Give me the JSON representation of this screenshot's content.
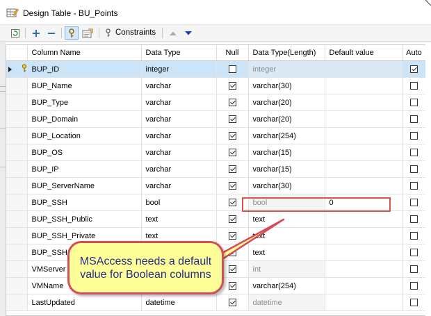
{
  "window": {
    "title": "Design Table - BU_Points"
  },
  "toolbar": {
    "constraints_label": "Constraints"
  },
  "grid": {
    "columns": [
      "Column Name",
      "Data Type",
      "Null",
      "Data Type(Length)",
      "Default value",
      "Auto"
    ],
    "rows": [
      {
        "name": "BUP_ID",
        "type": "integer",
        "null": false,
        "type_length": "integer",
        "default": "",
        "auto": true
      },
      {
        "name": "BUP_Name",
        "type": "varchar",
        "null": true,
        "type_length": "varchar(30)",
        "default": "",
        "auto": false
      },
      {
        "name": "BUP_Type",
        "type": "varchar",
        "null": true,
        "type_length": "varchar(20)",
        "default": "",
        "auto": false
      },
      {
        "name": "BUP_Domain",
        "type": "varchar",
        "null": true,
        "type_length": "varchar(20)",
        "default": "",
        "auto": false
      },
      {
        "name": "BUP_Location",
        "type": "varchar",
        "null": true,
        "type_length": "varchar(254)",
        "default": "",
        "auto": false
      },
      {
        "name": "BUP_OS",
        "type": "varchar",
        "null": true,
        "type_length": "varchar(15)",
        "default": "",
        "auto": false
      },
      {
        "name": "BUP_IP",
        "type": "varchar",
        "null": true,
        "type_length": "varchar(15)",
        "default": "",
        "auto": false
      },
      {
        "name": "BUP_ServerName",
        "type": "varchar",
        "null": true,
        "type_length": "varchar(30)",
        "default": "",
        "auto": false
      },
      {
        "name": "BUP_SSH",
        "type": "bool",
        "null": true,
        "type_length": "bool",
        "default": "0",
        "auto": false
      },
      {
        "name": "BUP_SSH_Public",
        "type": "text",
        "null": true,
        "type_length": "text",
        "default": "",
        "auto": false
      },
      {
        "name": "BUP_SSH_Private",
        "type": "text",
        "null": true,
        "type_length": "text",
        "default": "",
        "auto": false
      },
      {
        "name": "BUP_SSH_",
        "type": "",
        "null": true,
        "type_length": "text",
        "default": "",
        "auto": false
      },
      {
        "name": "VMServer",
        "type": "",
        "null": true,
        "type_length": "int",
        "default": "",
        "auto": false
      },
      {
        "name": "VMName",
        "type": "",
        "null": true,
        "type_length": "varchar(254)",
        "default": "",
        "auto": false
      },
      {
        "name": "LastUpdated",
        "type": "datetime",
        "null": true,
        "type_length": "datetime",
        "default": "",
        "auto": false
      }
    ]
  },
  "callout": {
    "line1": "MSAccess needs a default",
    "line2": "value for Boolean columns"
  },
  "colors": {
    "selection": "#cce4f7",
    "callout_fill": "#ffff99",
    "callout_border": "#d64b5a",
    "callout_text": "#1f2d8c",
    "highlight_border": "#d9534f"
  }
}
